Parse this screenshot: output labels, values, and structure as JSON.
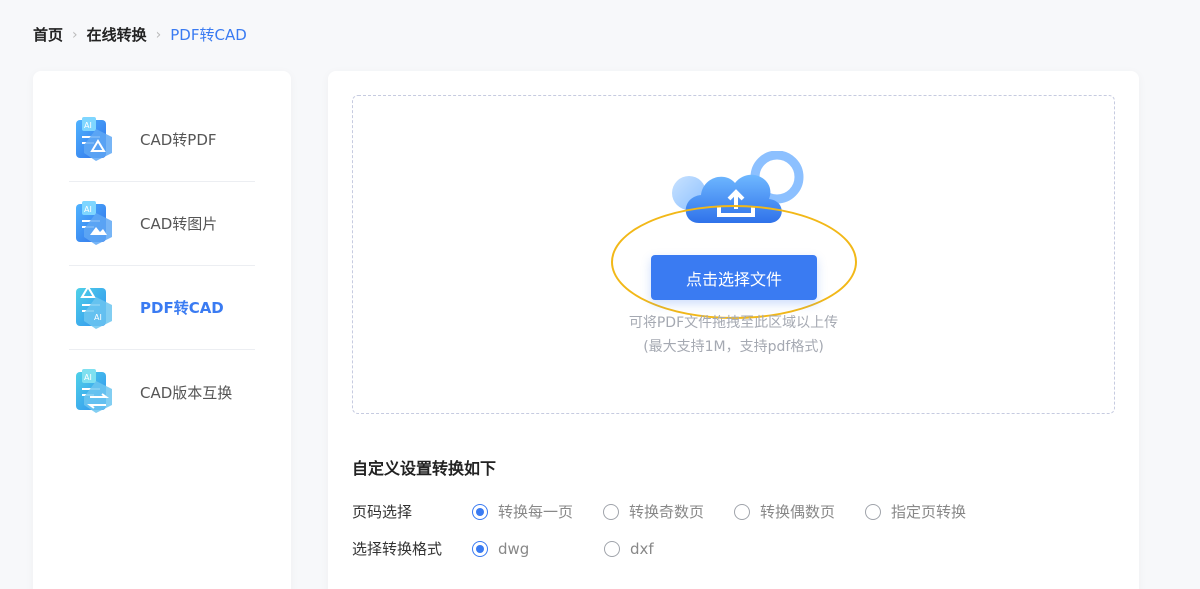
{
  "breadcrumb": {
    "home": "首页",
    "section": "在线转换",
    "current": "PDF转CAD"
  },
  "sidebar": {
    "items": [
      {
        "label": "CAD转PDF",
        "icon": "cad-to-pdf-icon",
        "active": false
      },
      {
        "label": "CAD转图片",
        "icon": "cad-to-image-icon",
        "active": false
      },
      {
        "label": "PDF转CAD",
        "icon": "pdf-to-cad-icon",
        "active": true
      },
      {
        "label": "CAD版本互换",
        "icon": "cad-version-swap-icon",
        "active": false
      }
    ]
  },
  "upload": {
    "button_label": "点击选择文件",
    "hint_line1": "可将PDF文件拖拽至此区域以上传",
    "hint_line2": "(最大支持1M，支持pdf格式)"
  },
  "settings": {
    "title": "自定义设置转换如下",
    "page_select": {
      "label": "页码选择",
      "options": [
        "转换每一页",
        "转换奇数页",
        "转换偶数页",
        "指定页转换"
      ],
      "selected": "转换每一页"
    },
    "format_select": {
      "label": "选择转换格式",
      "options": [
        "dwg",
        "dxf"
      ],
      "selected": "dwg"
    }
  },
  "colors": {
    "accent": "#3a7bf2",
    "highlight": "#f2b818",
    "background": "#f7f8fa"
  }
}
